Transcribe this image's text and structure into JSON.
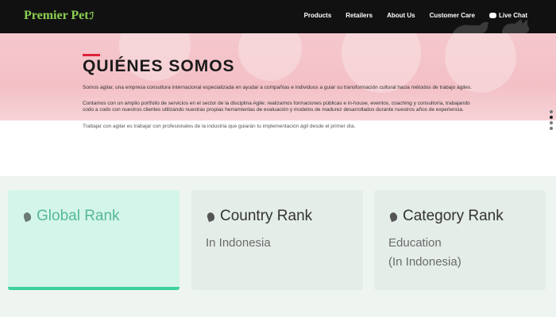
{
  "nav": {
    "brand": "Premier Pet",
    "links": [
      "Products",
      "Retailers",
      "About Us",
      "Customer Care",
      "Live Chat"
    ]
  },
  "hero": {
    "title": "QUIÉNES SOMOS",
    "p1": "Somos agilar, una empresa consultora internacional especializada en ayudar a compañías e individuos a guiar su transformación cultural hacia métodos de trabajo ágiles.",
    "p2": "Contamos con un amplio portfolio de servicios en el sector de la disciplina Agile: realizamos formaciones públicas e in-house, eventos, coaching y consultoría, trabajando codo a codo con nuestros clientes utilizando nuestras propias herramientas de evaluación y modelos de madurez desarrollados durante nuestros años de experiencia.",
    "p3": "Trabajar con agilar es trabajar con profesionales de la industria que guiarán tu implementación ágil desde el primer día."
  },
  "ranks": [
    {
      "title": "Global Rank",
      "sub": ""
    },
    {
      "title": "Country Rank",
      "sub": "In Indonesia"
    },
    {
      "title": "Category Rank",
      "sub": "Education",
      "sub2": "(In Indonesia)"
    }
  ],
  "colors": {
    "brand": "#8ccf52",
    "accent": "#e0223a",
    "rank_active": "#3bd19a"
  },
  "icons": {
    "rank": "leaf-icon",
    "chat": "chat-bubble-icon"
  }
}
